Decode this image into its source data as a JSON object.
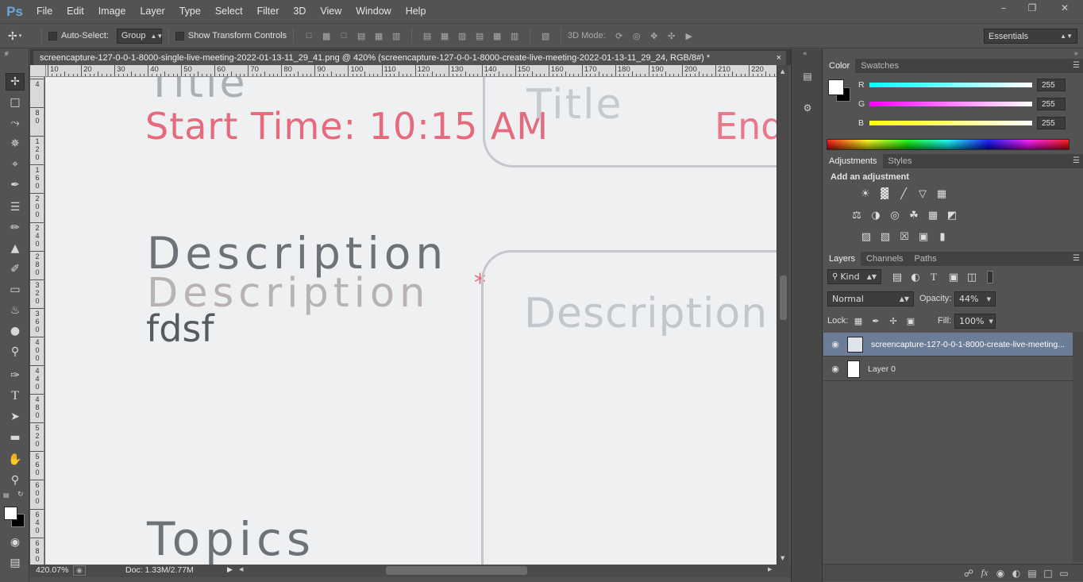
{
  "app": {
    "logo": "Ps",
    "menu": [
      "File",
      "Edit",
      "Image",
      "Layer",
      "Type",
      "Select",
      "Filter",
      "3D",
      "View",
      "Window",
      "Help"
    ],
    "window_controls": [
      "minimize-icon",
      "restore-icon",
      "close-icon"
    ]
  },
  "options_bar": {
    "auto_select_label": "Auto-Select:",
    "auto_select_checked": false,
    "auto_select_value": "Group",
    "show_transform_label": "Show Transform Controls",
    "show_transform_checked": false,
    "mode_3d_label": "3D Mode:",
    "workspace": "Essentials"
  },
  "document": {
    "tab_title": "screencapture-127-0-0-1-8000-single-live-meeting-2022-01-13-11_29_41.png @ 420% (screencapture-127-0-0-1-8000-create-live-meeting-2022-01-13-11_29_24, RGB/8#) *",
    "close": "×",
    "zoom": "420.07%",
    "doc_size": "Doc: 1.33M/2.77M"
  },
  "rulers": {
    "horizontal": [
      "10",
      "20",
      "30",
      "40",
      "50",
      "60",
      "70",
      "80",
      "90",
      "100",
      "110",
      "120",
      "130",
      "140",
      "150",
      "160",
      "170",
      "180",
      "190",
      "200",
      "210",
      "220"
    ],
    "vertical": [
      [
        "4"
      ],
      [
        "8",
        "0"
      ],
      [
        "1",
        "2",
        "0"
      ],
      [
        "1",
        "6",
        "0"
      ],
      [
        "2",
        "0",
        "0"
      ],
      [
        "2",
        "4",
        "0"
      ],
      [
        "2",
        "8",
        "0"
      ],
      [
        "3",
        "2",
        "0"
      ],
      [
        "3",
        "6",
        "0"
      ],
      [
        "4",
        "0",
        "0"
      ],
      [
        "4",
        "4",
        "0"
      ],
      [
        "4",
        "8",
        "0"
      ],
      [
        "5",
        "2",
        "0"
      ],
      [
        "5",
        "6",
        "0"
      ],
      [
        "6",
        "0",
        "0"
      ],
      [
        "6",
        "4",
        "0"
      ],
      [
        "6",
        "8",
        "0"
      ]
    ]
  },
  "canvas_text": {
    "title_top": "Title",
    "start_time": "Start Time: 10:15 AM",
    "end_partial": "End",
    "title_ghost": "Title",
    "description_1": "Description",
    "description_2": "Description",
    "asterisk": "*",
    "fdsf": "fdsf",
    "description_ghost": "Description",
    "topics": "Topics"
  },
  "color_panel": {
    "tabs": [
      "Color",
      "Swatches"
    ],
    "channels": [
      {
        "label": "R",
        "value": "255"
      },
      {
        "label": "G",
        "value": "255"
      },
      {
        "label": "B",
        "value": "255"
      }
    ]
  },
  "adjustments_panel": {
    "tabs": [
      "Adjustments",
      "Styles"
    ],
    "heading": "Add an adjustment",
    "icons": [
      "brightness-contrast-icon",
      "levels-icon",
      "curves-icon",
      "exposure-icon",
      "vibrance-icon",
      "hue-saturation-icon",
      "color-balance-icon",
      "black-white-icon",
      "photo-filter-icon",
      "channel-mixer-icon",
      "color-lookup-icon",
      "invert-icon",
      "posterize-icon",
      "threshold-icon",
      "selective-color-icon",
      "gradient-map-icon"
    ]
  },
  "layers_panel": {
    "tabs": [
      "Layers",
      "Channels",
      "Paths"
    ],
    "filter_kind": "Kind",
    "blend_mode": "Normal",
    "opacity_label": "Opacity:",
    "opacity_value": "44%",
    "lock_label": "Lock:",
    "fill_label": "Fill:",
    "fill_value": "100%",
    "layers": [
      {
        "name": "screencapture-127-0-0-1-8000-create-live-meeting...",
        "visible": true,
        "selected": true
      },
      {
        "name": "Layer 0",
        "visible": true,
        "selected": false
      }
    ]
  },
  "colors": {
    "ui_dark": "#535353",
    "selection": "#6b7d97",
    "ps_blue": "#6ea6dc",
    "start_time_red": "#e46a7c",
    "text_gray": "#6f7179"
  }
}
